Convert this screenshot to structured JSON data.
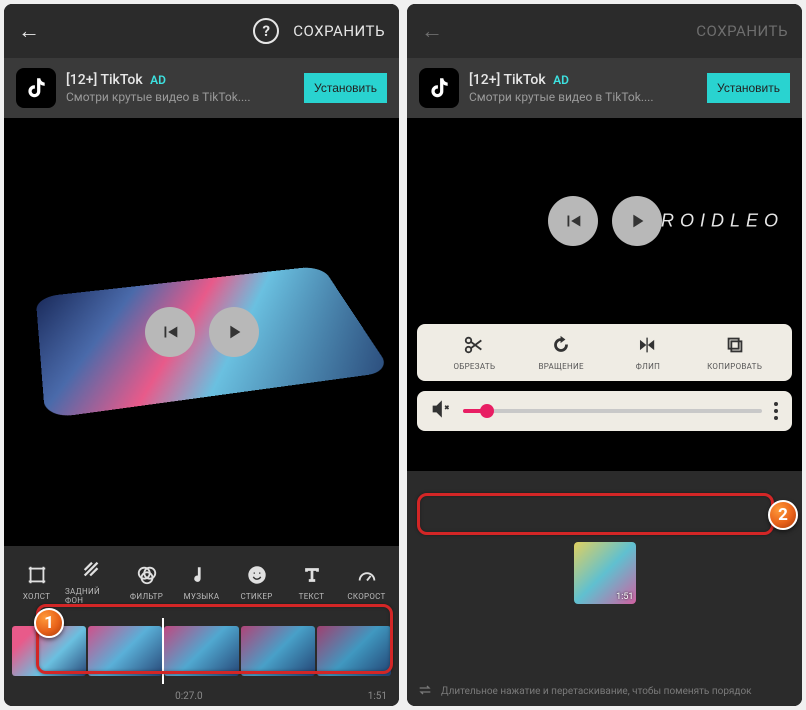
{
  "header": {
    "save_label": "СОХРАНИТЬ",
    "help_glyph": "?"
  },
  "ad": {
    "title": "[12+] TikTok",
    "badge": "AD",
    "subtitle": "Смотри крутые видео в TikTok....",
    "cta": "Установить"
  },
  "brand_text": "DROIDLEO",
  "tools": {
    "crop": "ХОЛСТ",
    "bg": "ЗАДНИЙ ФОН",
    "filter": "ФИЛЬТР",
    "music": "МУЗЫКА",
    "sticker": "СТИКЕР",
    "text": "ТЕКСТ",
    "speed": "СКОРОСТ"
  },
  "edit_tools": {
    "trim": "ОБРЕЗАТЬ",
    "rotate": "ВРАЩЕНИЕ",
    "flip": "ФЛИП",
    "copy": "КОПИРОВАТЬ"
  },
  "timeline": {
    "current": "0:27.0",
    "total": "1:51"
  },
  "clip": {
    "duration": "1:51"
  },
  "hint": "Длительное нажатие и перетаскивание, чтобы поменять порядок",
  "markers": {
    "m1": "1",
    "m2": "2"
  }
}
